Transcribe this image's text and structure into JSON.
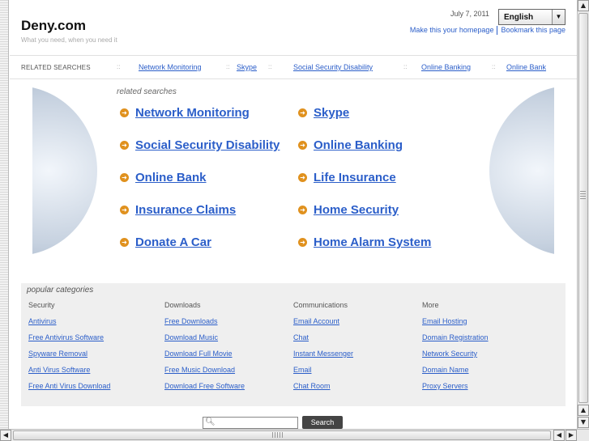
{
  "header": {
    "site_name": "Deny.com",
    "tagline": "What you need, when you need it",
    "date": "July 7, 2011",
    "language": "English",
    "make_homepage": "Make this your homepage",
    "bookmark": "Bookmark this page"
  },
  "related_bar": {
    "label": "RELATED SEARCHES",
    "separator": "::",
    "links": [
      "Network Monitoring",
      "Skype",
      "Social Security Disability",
      "Online Banking",
      "Online Bank"
    ]
  },
  "related_searches": {
    "title": "related searches",
    "left": [
      "Network Monitoring",
      "Social Security Disability",
      "Online Bank",
      "Insurance Claims",
      "Donate A Car"
    ],
    "right": [
      "Skype",
      "Online Banking",
      "Life Insurance",
      "Home Security",
      "Home Alarm System"
    ]
  },
  "popular": {
    "title": "popular categories",
    "columns": [
      {
        "header": "Security",
        "items": [
          "Antivirus",
          "Free Antivirus Software",
          "Spyware Removal",
          "Anti Virus Software",
          "Free Anti Virus Download"
        ]
      },
      {
        "header": "Downloads",
        "items": [
          "Free Downloads",
          "Download Music",
          "Download Full Movie",
          "Free Music Download",
          "Download Free Software"
        ]
      },
      {
        "header": "Communications",
        "items": [
          "Email Account",
          "Chat",
          "Instant Messenger",
          "Email",
          "Chat Room"
        ]
      },
      {
        "header": "More",
        "items": [
          "Email Hosting",
          "Domain Registration",
          "Network Security",
          "Domain Name",
          "Proxy Servers"
        ]
      }
    ]
  },
  "search": {
    "button_label": "Search"
  },
  "icons": {
    "bullet": "arrow-right-icon",
    "search": "magnifier-icon"
  },
  "colors": {
    "link": "#2b5ec9",
    "bullet": "#e0911e",
    "panel": "#efefef"
  }
}
